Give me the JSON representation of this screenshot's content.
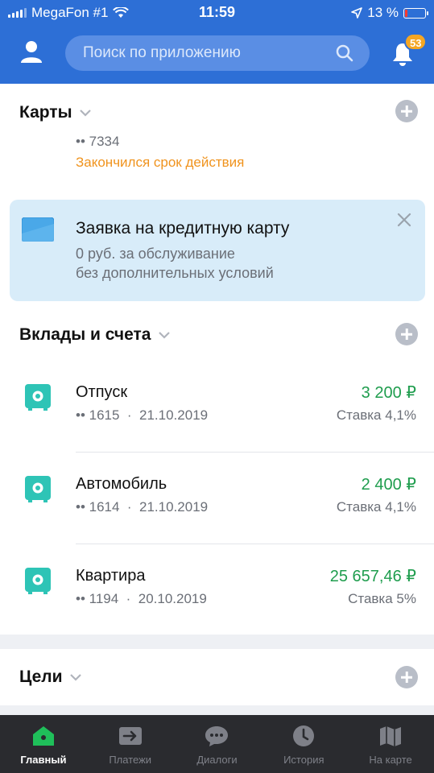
{
  "status_bar": {
    "carrier": "MegaFon #1",
    "time": "11:59",
    "battery": "13 %",
    "battery_level": 0.13
  },
  "header": {
    "search_placeholder": "Поиск по приложению",
    "notifications_count": "53"
  },
  "cards_section": {
    "title": "Карты",
    "card_number": "•• 7334",
    "card_status": "Закончился срок действия"
  },
  "promo": {
    "title": "Заявка на кредитную карту",
    "line1": "0 руб. за обслуживание",
    "line2": "без дополнительных условий"
  },
  "deposits_section": {
    "title": "Вклады и счета",
    "items": [
      {
        "name": "Отпуск",
        "account": "•• 1615",
        "date": "21.10.2019",
        "amount": "3 200 ₽",
        "rate": "Ставка 4,1%"
      },
      {
        "name": "Автомобиль",
        "account": "•• 1614",
        "date": "21.10.2019",
        "amount": "2 400 ₽",
        "rate": "Ставка 4,1%"
      },
      {
        "name": "Квартира",
        "account": "•• 1194",
        "date": "20.10.2019",
        "amount": "25 657,46 ₽",
        "rate": "Ставка 5%"
      }
    ]
  },
  "goals_section": {
    "title": "Цели"
  },
  "tabs": [
    {
      "label": "Главный",
      "icon": "home-icon",
      "active": true
    },
    {
      "label": "Платежи",
      "icon": "transfer-icon",
      "active": false
    },
    {
      "label": "Диалоги",
      "icon": "chat-icon",
      "active": false
    },
    {
      "label": "История",
      "icon": "clock-icon",
      "active": false
    },
    {
      "label": "На карте",
      "icon": "map-icon",
      "active": false
    }
  ],
  "colors": {
    "brand_blue": "#2d6fd6",
    "amount_green": "#1f9d4e",
    "warning_orange": "#f0931d",
    "badge_orange": "#f5a623",
    "deposit_icon_teal": "#2ec4b6",
    "tabbar_bg": "#2a2b2f",
    "active_tab_green": "#1fbf5a"
  }
}
